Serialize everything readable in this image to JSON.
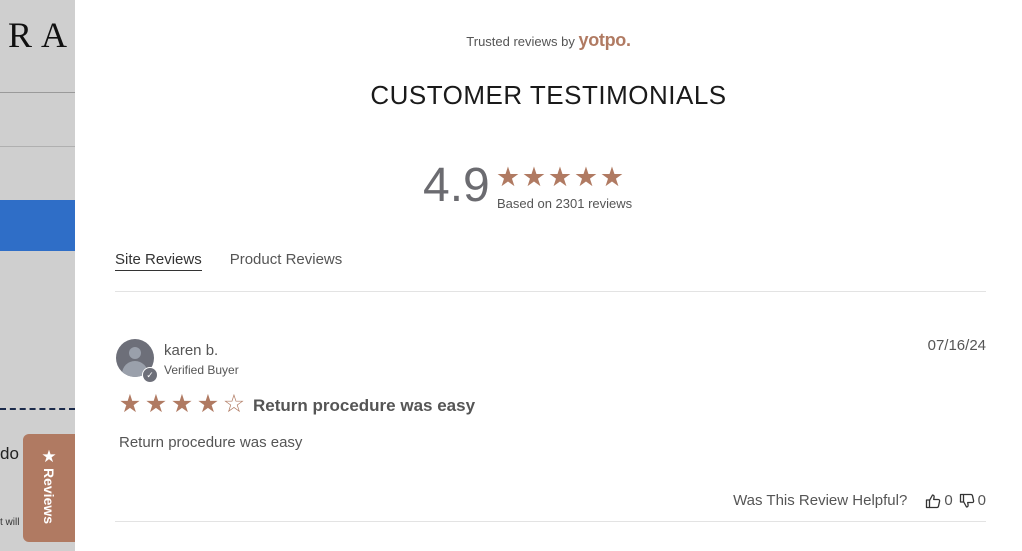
{
  "background": {
    "brand_fragment": "RA",
    "text_fragment_1": "do",
    "text_fragment_2": "t will"
  },
  "reviews_tab": {
    "star": "★",
    "label": "Reviews"
  },
  "header": {
    "trusted_prefix": "Trusted reviews by",
    "trusted_brand": "yotpo.",
    "title": "CUSTOMER TESTIMONIALS"
  },
  "summary": {
    "score": "4.9",
    "stars": [
      "★",
      "★",
      "★",
      "★",
      "★"
    ],
    "based_on": "Based on 2301 reviews"
  },
  "tabs": [
    {
      "label": "Site Reviews",
      "active": true
    },
    {
      "label": "Product Reviews",
      "active": false
    }
  ],
  "review": {
    "name": "karen b.",
    "status": "Verified Buyer",
    "date": "07/16/24",
    "rating": 4,
    "stars": [
      "★",
      "★",
      "★",
      "★",
      "☆"
    ],
    "title": "Return procedure was easy",
    "body": "Return procedure was easy",
    "helpful_question": "Was This Review Helpful?",
    "upvotes": "0",
    "downvotes": "0"
  },
  "colors": {
    "accent": "#b07a62",
    "overlay": "#cfcfcf",
    "bluebar": "#2f6ec7"
  }
}
